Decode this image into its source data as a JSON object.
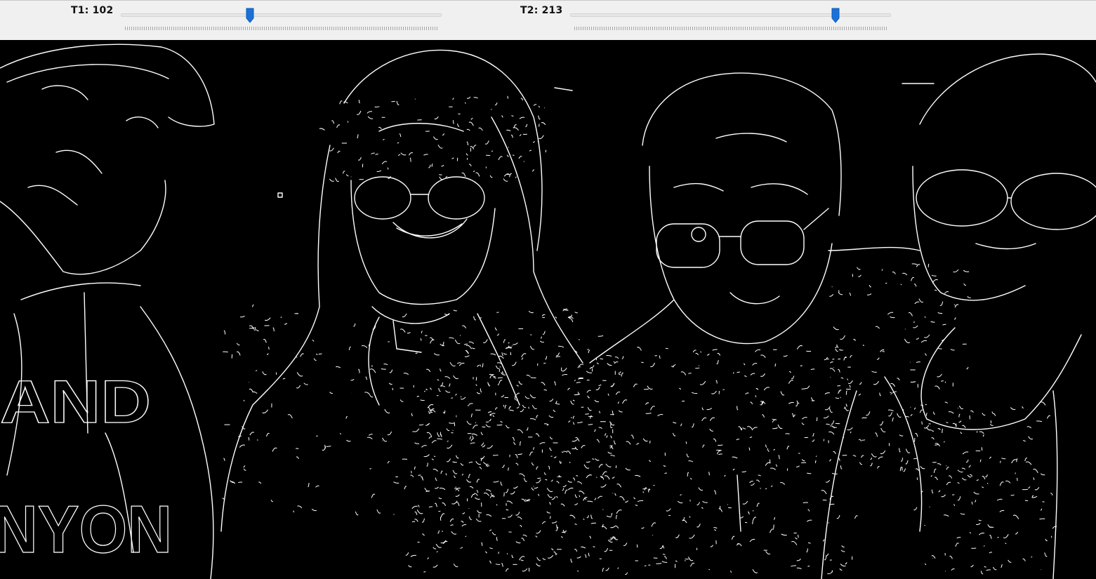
{
  "controls": {
    "t1": {
      "label": "T1: 102",
      "value": 102,
      "min": 0,
      "max": 255
    },
    "t2": {
      "label": "T2: 213",
      "value": 213,
      "min": 0,
      "max": 255
    }
  },
  "image": {
    "icon": "edge-detection-output-image",
    "colors": {
      "edges": "#ffffff",
      "background": "#000000"
    },
    "jersey_letters_top": "AND",
    "jersey_letters_bottom": "NYON"
  },
  "colors": {
    "accent": "#1a72d9",
    "toolbar_bg": "#f0f0f0"
  }
}
